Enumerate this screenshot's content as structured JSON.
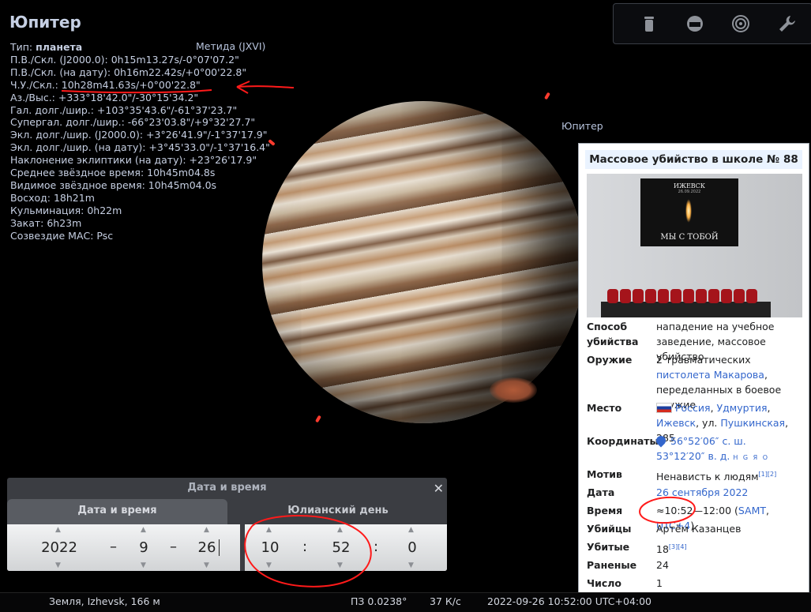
{
  "object": {
    "title": "Юпитер",
    "type_label": "Тип: ",
    "type_value": "планета",
    "moon_label": "Метида (JXVI)",
    "sky_label": "Юпитер",
    "rows": [
      "П.В./Скл. (J2000.0): 0h15m13.27s/-0°07'07.2\"",
      "П.В./Скл. (на дату): 0h16m22.42s/+0°00'22.8\"",
      "Ч.У./Скл.: 10h28m41.63s/+0°00'22.8\"",
      "Аз./Выс.: +333°18'42.0\"/-30°15'34.2\"",
      "Гал. долг./шир.: +103°35'43.6\"/-61°37'23.7\"",
      "Супергал. долг./шир.: -66°23'03.8\"/+9°32'27.7\"",
      "Экл. долг./шир. (J2000.0): +3°26'41.9\"/-1°37'17.9\"",
      "Экл. долг./шир. (на дату): +3°45'33.0\"/-1°37'16.4\"",
      "Наклонение эклиптики (на дату): +23°26'17.9\"",
      "Среднее звёздное время: 10h45m04.8s",
      "Видимое звёздное время: 10h45m04.0s",
      "Восход: 18h21m",
      "Кульминация: 0h22m",
      "Закат: 6h23m",
      "Созвездие МАС: Psc"
    ]
  },
  "toolbar": {
    "icons": [
      "trash-icon",
      "window-icon",
      "target-icon",
      "wrench-icon"
    ]
  },
  "wiki": {
    "title": "Массовое убийство в школе № 88",
    "photo": {
      "poster_city": "ИЖЕВСК",
      "poster_date": "26.09.2022",
      "poster_caption": "МЫ С ТОБОЙ"
    },
    "rows": {
      "method_label": "Способ убийства",
      "method_value": "нападение на учебное заведение, массовое убийство",
      "weapon_label": "Оружие",
      "weapon_a": "2 травматических ",
      "weapon_link1": "пистолета Макарова",
      "weapon_b": ", переделанных в боевое оружие",
      "place_label": "Место",
      "place_russia": "Россия",
      "place_udm": "Удмуртия",
      "place_izh": "Ижевск",
      "place_street_a": "ул. ",
      "place_street_link": "Пушкинская",
      "place_street_b": ", 285",
      "coords_label": "Координаты",
      "coords_1": "56°52′06″ с. ш.",
      "coords_2": "53°12′20″ в. д.",
      "coords_geo": "H G Я O",
      "motive_label": "Мотив",
      "motive_value": "Ненависть к людям",
      "motive_refs": "[1][2]",
      "date_label": "Дата",
      "date_value": "26 сентября 2022",
      "time_label": "Время",
      "time_value": "≈10:52—12:00 (",
      "time_tz1": "SAMT",
      "time_sep": ", ",
      "time_tz2": "UTC+4",
      "time_close": ")",
      "killers_label": "Убийцы",
      "killers_value": "Артём Казанцев",
      "killed_label": "Убитые",
      "killed_value": "18",
      "killed_refs": "[3][4]",
      "injured_label": "Раненые",
      "injured_value": "24",
      "count_label": "Число убийц",
      "count_value": "1"
    }
  },
  "datetime_dialog": {
    "title": "Дата и время",
    "tab_active": "Дата и время",
    "tab_other": "Юлианский день",
    "year": "2022",
    "month": "9",
    "day": "26",
    "hour": "10",
    "minute": "52",
    "second": "0",
    "date_sep": "–",
    "time_sep": ":"
  },
  "status": {
    "location": "Земля, Izhevsk, 166 м",
    "fov": "ПЗ 0.0238°",
    "fps": "37 К/с",
    "datetime": "2022-09-26 10:52:00 UTC+04:00"
  },
  "colors": {
    "annotation": "#ff0000",
    "link": "#3366cc",
    "dialog_bg": "#3b3d42"
  }
}
